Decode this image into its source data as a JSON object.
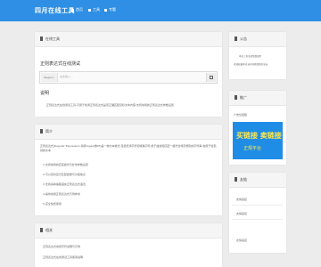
{
  "header": {
    "logo": "四月在线工具",
    "nav": [
      "首页",
      "工具",
      "专题"
    ]
  },
  "main_tool": {
    "title": "在线工具",
    "page_title": "正则表达式在线测试",
    "input_prefix": "Regex:/",
    "input_placeholder": "在此输入...",
    "section_title": "说明",
    "desc_line": "正则表达式在线测试工具,可用于检测正则表达式是否正确匹配目标文本内容,支持常用的正则表达式参数设置"
  },
  "intro_card": {
    "title": "简介",
    "para": "正则表达式(Regular Expression,简称regex或RE)是一种文本模式,包括普通字符和特殊字符,用于描述和匹配一组符合特定规则的字符串,常用于检索、替换文本",
    "items": [
      "1.支持常用的匹配模式与标志参数设置",
      "2.可以实时显示匹配结果与分组信息",
      "3.支持多种编程语言正则表达式语法",
      "4.提供常用正则表达式示例参考",
      "5.完全免费使用"
    ]
  },
  "bottom_card": {
    "title": "相关",
    "items": [
      "正则表达式常用字符说明与示例",
      "正则表达式在线测试工具使用说明"
    ]
  },
  "sidebar": {
    "notice_title": "公告",
    "notice_lines": [
      "本站工具全部免费使用",
      "欢迎收藏本站,如有问题请联系站长"
    ],
    "promo_title": "推广",
    "promo_heading": "广告位招租",
    "ad_line1": "买链接 卖链接",
    "ad_line2": "正规平台",
    "links_title": "友链",
    "links": [
      "友情链接",
      "友情链接",
      "友情链接"
    ]
  }
}
